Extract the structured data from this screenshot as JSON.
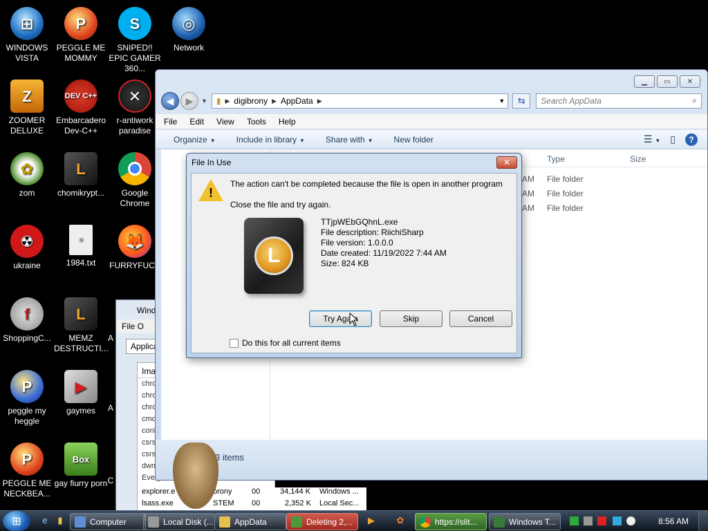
{
  "desktop": {
    "icons": [
      {
        "label": "WINDOWS VISTA"
      },
      {
        "label": "PEGGLE ME MOMMY"
      },
      {
        "label": "SNIPED!! EPIC GAMER 360..."
      },
      {
        "label": "Network"
      },
      {
        "label": "ZOOMER DELUXE"
      },
      {
        "label": "Embarcadero Dev-C++"
      },
      {
        "label": "r-antiwork paradise"
      },
      {
        "label": "zom"
      },
      {
        "label": "chomikrypt..."
      },
      {
        "label": "Google Chrome"
      },
      {
        "label": "ukraine"
      },
      {
        "label": "1984.txt"
      },
      {
        "label": "FURRYFUCK"
      },
      {
        "label": "ShoppingC..."
      },
      {
        "label": "MEMZ DESTRUCTI..."
      },
      {
        "label": "A"
      },
      {
        "label": "peggle my heggle"
      },
      {
        "label": "gaymes"
      },
      {
        "label": "A"
      },
      {
        "label": "PEGGLE ME NECKBEA..."
      },
      {
        "label": "gay fiurry porn"
      },
      {
        "label": "C"
      }
    ],
    "icon_glyphs": {
      "dev": "DEV C++",
      "box": "Box"
    }
  },
  "taskmgr": {
    "title": "Wind",
    "menu": "File  O",
    "tab": "Applicat",
    "col_header": "Ima",
    "rows": [
      "chro",
      "chro",
      "chro",
      "cmd",
      "conh",
      "csrs",
      "csrs",
      "dwm",
      "Every"
    ],
    "bottom_rows": [
      {
        "name": "explorer.e",
        "user": "brony",
        "cpu": "00",
        "mem": "34,144 K",
        "desc": "Windows ..."
      },
      {
        "name": "lsass.exe",
        "user": "STEM",
        "cpu": "00",
        "mem": "2,352 K",
        "desc": "Local Sec..."
      }
    ]
  },
  "explorer": {
    "breadcrumb": [
      "digibrony",
      "AppData"
    ],
    "search_placeholder": "Search AppData",
    "menu": [
      "File",
      "Edit",
      "View",
      "Tools",
      "Help"
    ],
    "commands": [
      "Organize",
      "Include in library",
      "Share with",
      "New folder"
    ],
    "columns": {
      "type": "Type",
      "size": "Size"
    },
    "rows": [
      {
        "time": "AM",
        "type": "File folder"
      },
      {
        "time": "AM",
        "type": "File folder"
      },
      {
        "time": "AM",
        "type": "File folder"
      }
    ],
    "status": "3 items"
  },
  "dialog": {
    "title": "File In Use",
    "message": "The action can't be completed because the file is open in another program",
    "instruction": "Close the file and try again.",
    "file": {
      "name": "TTjpWEbGQhnL.exe",
      "description": "File description: RiichiSharp",
      "version": "File version: 1.0.0.0",
      "created": "Date created: 11/19/2022 7:44 AM",
      "size": "Size: 824 KB"
    },
    "icon_letter": "L",
    "buttons": {
      "try_again": "Try Again",
      "skip": "Skip",
      "cancel": "Cancel"
    },
    "checkbox_label": "Do this for all current items"
  },
  "taskbar": {
    "buttons": [
      {
        "label": "Computer"
      },
      {
        "label": "Local Disk (..."
      },
      {
        "label": "AppData"
      },
      {
        "label": "Deleting 2,..."
      },
      {
        "label": "https://slit..."
      },
      {
        "label": "Windows T..."
      }
    ],
    "clock": "8:56 AM"
  },
  "colors": {
    "desktop_bg": "#000000",
    "dialog_frame": "#bdd1ea",
    "warning": "#f2c12e",
    "taskbar_red": "#b83a2f"
  }
}
